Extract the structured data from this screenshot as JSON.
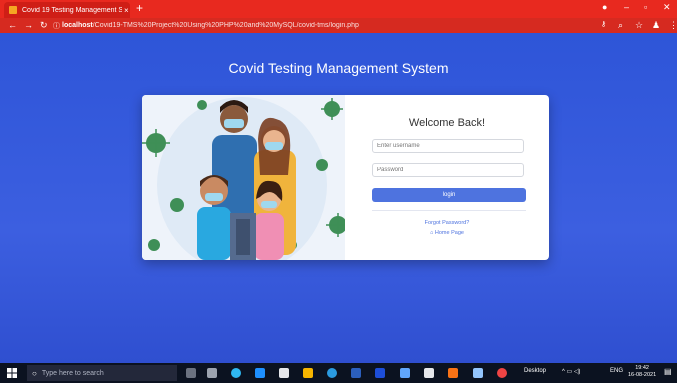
{
  "browser": {
    "tab_title": "Covid 19 Testing Management S...",
    "tab_close": "×",
    "new_tab": "+",
    "url_host": "localhost",
    "url_path": "/Covid19-TMS%20Project%20Using%20PHP%20and%20MySQL/covid-tms/login.php"
  },
  "page": {
    "title": "Covid Testing Management System"
  },
  "login": {
    "heading": "Welcome Back!",
    "username_placeholder": "Enter username",
    "password_placeholder": "Password",
    "button": "login",
    "forgot_password": "Forgot Password?",
    "home_page": "Home Page"
  },
  "taskbar": {
    "search_placeholder": "Type here to search",
    "desktop_label": "Desktop",
    "language": "ENG",
    "time": "19:42",
    "date": "16-08-2021"
  },
  "colors": {
    "browser_bar": "#e8291f",
    "page_background": "#2c4bd0",
    "button": "#4e73df",
    "taskbar": "#0b1220"
  }
}
